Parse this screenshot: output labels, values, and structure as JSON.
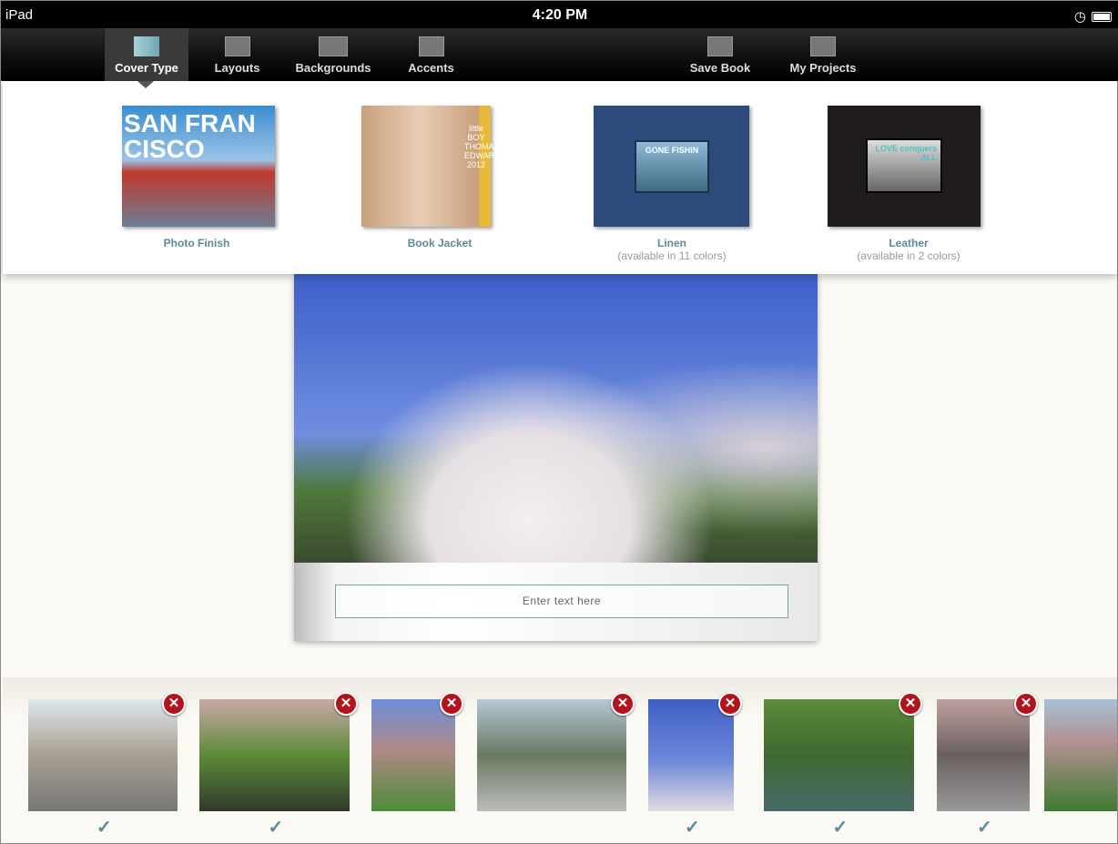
{
  "status": {
    "device": "iPad",
    "time": "4:20 PM"
  },
  "toolbar": {
    "items": [
      {
        "label": "Cover Type",
        "icon": "book-icon",
        "active": true
      },
      {
        "label": "Layouts",
        "icon": "layout-icon"
      },
      {
        "label": "Backgrounds",
        "icon": "landscape-icon"
      },
      {
        "label": "Accents",
        "icon": "flower-icon"
      },
      {
        "label": "Save Book",
        "icon": "save-icon"
      },
      {
        "label": "My Projects",
        "icon": "folder-icon"
      }
    ]
  },
  "cover_types": [
    {
      "label": "Photo Finish",
      "sub": "",
      "cover_text": "SAN FRAN CISCO"
    },
    {
      "label": "Book Jacket",
      "sub": "",
      "cover_text": "little BOY THOMAS EDWARDS 2012"
    },
    {
      "label": "Linen",
      "sub": "(available in 11 colors)",
      "cover_text": "GONE FISHIN"
    },
    {
      "label": "Leather",
      "sub": "(available in 2 colors)",
      "cover_text": "LOVE conquers ALL"
    }
  ],
  "book": {
    "text_placeholder": "Enter text here"
  },
  "thumbnails": [
    {
      "checked": true
    },
    {
      "checked": true
    },
    {
      "checked": false
    },
    {
      "checked": false
    },
    {
      "checked": true
    },
    {
      "checked": true
    },
    {
      "checked": true
    },
    {
      "checked": false
    }
  ],
  "colors": {
    "accent": "#5b8a9a",
    "remove": "#b3141c"
  }
}
